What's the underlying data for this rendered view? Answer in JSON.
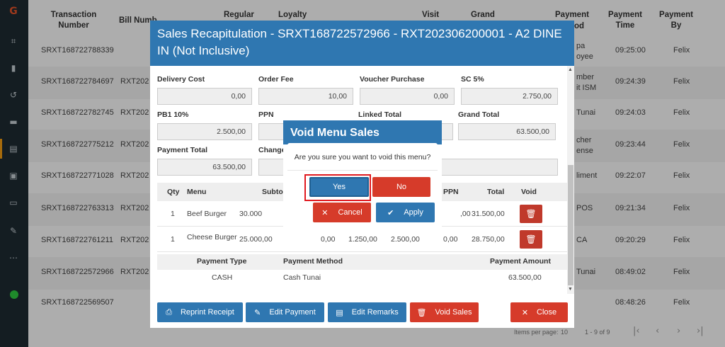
{
  "sidebar": {
    "icons": [
      "app-logo-icon",
      "dashboard-icon",
      "book-icon",
      "history-icon",
      "truck-icon",
      "sales-icon",
      "contacts-icon",
      "cash-icon",
      "wrench-icon",
      "more-icon",
      "status-online-icon"
    ]
  },
  "table": {
    "headers": {
      "transaction_number": "Transaction Number",
      "bill_number": "Bill Numb",
      "regular": "Regular",
      "loyalty": "Loyalty",
      "visit": "Visit",
      "grand": "Grand",
      "payment_method": "Payment",
      "payment_method_2": "od",
      "payment_time": "Payment Time",
      "payment_by": "Payment By"
    },
    "rows": [
      {
        "trx": "SRXT168722788339",
        "bill": "",
        "method": "pa",
        "method2": "oyee",
        "time": "09:25:00",
        "by": "Felix"
      },
      {
        "trx": "SRXT168722784697",
        "bill": "RXT202",
        "method": "mber",
        "method2": "it ISM",
        "time": "09:24:39",
        "by": "Felix"
      },
      {
        "trx": "SRXT168722782745",
        "bill": "RXT202",
        "method": "Tunai",
        "method2": "",
        "time": "09:24:03",
        "by": "Felix"
      },
      {
        "trx": "SRXT168722775212",
        "bill": "RXT202",
        "method": "cher",
        "method2": "ense",
        "time": "09:23:44",
        "by": "Felix"
      },
      {
        "trx": "SRXT168722771028",
        "bill": "RXT202",
        "method": "liment",
        "method2": "",
        "time": "09:22:07",
        "by": "Felix"
      },
      {
        "trx": "SRXT168722763313",
        "bill": "RXT202",
        "method": "POS",
        "method2": "",
        "time": "09:21:34",
        "by": "Felix"
      },
      {
        "trx": "SRXT168722761211",
        "bill": "RXT202",
        "method": "CA",
        "method2": "",
        "time": "09:20:29",
        "by": "Felix"
      },
      {
        "trx": "SRXT168722572966",
        "bill": "RXT202",
        "method": "Tunai",
        "method2": "",
        "time": "08:49:02",
        "by": "Felix"
      },
      {
        "trx": "SRXT168722569507",
        "bill": "",
        "method": "",
        "method2": "",
        "time": "08:48:26",
        "by": "Felix"
      }
    ],
    "pager": {
      "items_per_page_label": "Items per page:",
      "items_per_page": "10",
      "range": "1 - 9 of 9"
    }
  },
  "modal": {
    "title": "Sales Recapitulation - SRXT168722572966 - RXT202306200001 - A2 DINE IN (Not Inclusive)",
    "fields": {
      "delivery_cost": {
        "label": "Delivery Cost",
        "value": "0,00"
      },
      "order_fee": {
        "label": "Order Fee",
        "value": "10,00"
      },
      "voucher_purchase": {
        "label": "Voucher Purchase",
        "value": "0,00"
      },
      "sc": {
        "label": "SC 5%",
        "value": "2.750,00"
      },
      "pb1": {
        "label": "PB1 10%",
        "value": "2.500,00"
      },
      "ppn": {
        "label": "PPN",
        "value": ""
      },
      "linked_total": {
        "label": "Linked Total",
        "value": ""
      },
      "grand_total": {
        "label": "Grand Total",
        "value": "63.500,00"
      },
      "payment_total": {
        "label": "Payment Total",
        "value": "63.500,00"
      },
      "change": {
        "label": "Change",
        "value": ""
      }
    },
    "menu_table": {
      "headers": {
        "qty": "Qty",
        "menu": "Menu",
        "subtotal": "Subto",
        "ppn": "PPN",
        "total": "Total",
        "void": "Void"
      },
      "rows": [
        {
          "qty": "1",
          "menu": "Beef Burger",
          "subtotal": "30.000",
          "c1": "",
          "c2": "",
          "c3": "",
          "ppn": ",00",
          "total": "31.500,00"
        },
        {
          "qty": "1",
          "menu": "Cheese Burger",
          "subtotal": "25.000,00",
          "c1": "0,00",
          "c2": "1.250,00",
          "c3": "2.500,00",
          "ppn": "0,00",
          "total": "28.750,00"
        }
      ]
    },
    "payment_table": {
      "headers": {
        "type": "Payment Type",
        "method": "Payment Method",
        "amount": "Payment Amount"
      },
      "rows": [
        {
          "type": "CASH",
          "method": "Cash Tunai",
          "amount": "63.500,00"
        }
      ]
    },
    "buttons": {
      "reprint": "Reprint Receipt",
      "edit_payment": "Edit Payment",
      "edit_remarks": "Edit Remarks",
      "void_sales": "Void Sales",
      "close": "Close"
    }
  },
  "void_dialog": {
    "title": "Void Menu Sales",
    "cancel": "Cancel",
    "apply": "Apply"
  },
  "confirm": {
    "message": "Are you sure you want to void this menu?",
    "yes": "Yes",
    "no": "No"
  },
  "colors": {
    "primary": "#2f77b1",
    "danger": "#d63b2a",
    "sidebar": "#1e2b33",
    "highlight": "#e0191f"
  }
}
